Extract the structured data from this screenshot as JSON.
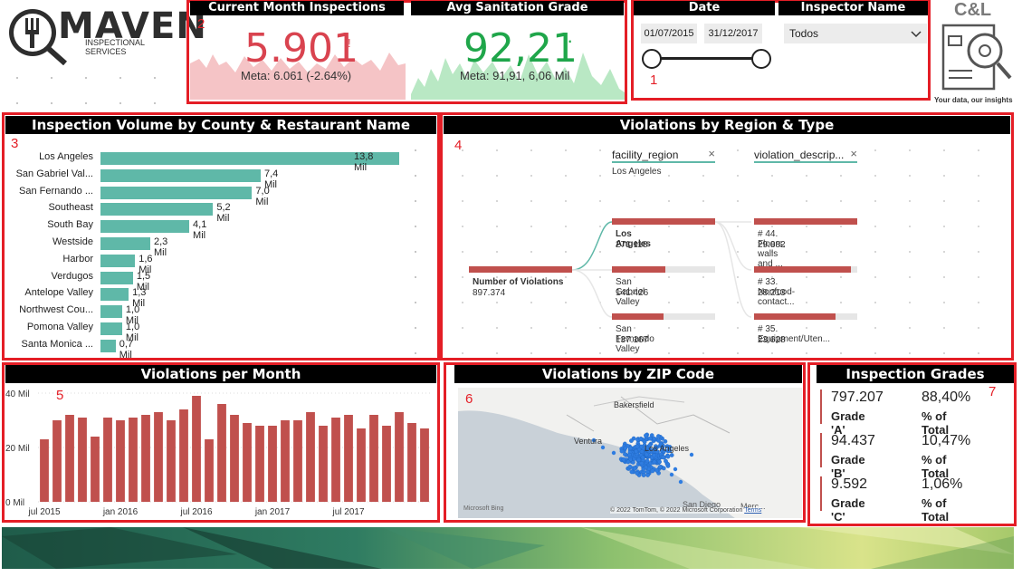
{
  "logo": {
    "title": "MAVEN",
    "subtitle": "INSPECTIONAL SERVICES",
    "brand": "C&L",
    "tagline": "Your data, our insights"
  },
  "kpis": {
    "current_month": {
      "header": "Current Month Inspections",
      "value": "5.901",
      "alert": "!",
      "goal": "Meta: 6.061 (-2.64%)",
      "color": "#d9434f"
    },
    "avg_grade": {
      "header": "Avg Sanitation Grade",
      "value": "92,21",
      "alert": "·",
      "goal": "Meta: 91,91, 6,06 Mil",
      "color": "#1fa64a"
    }
  },
  "slicers": {
    "date_header": "Date",
    "date_start": "01/07/2015",
    "date_end": "31/12/2017",
    "inspector_header": "Inspector Name",
    "inspector_value": "Todos"
  },
  "markers": [
    "1",
    "2",
    "3",
    "4",
    "5",
    "6",
    "7"
  ],
  "panels": {
    "county": "Inspection Volume by County & Restaurant Name",
    "region": "Violations by Region & Type",
    "monthly": "Violations per Month",
    "zip": "Violations by ZIP Code",
    "grades": "Inspection Grades"
  },
  "county_chart": {
    "chart_data": {
      "type": "bar",
      "categories": [
        "Los Angeles",
        "San Gabriel Val...",
        "San Fernando ...",
        "Southeast",
        "South Bay",
        "Westside",
        "Harbor",
        "Verdugos",
        "Antelope Valley",
        "Northwest Cou...",
        "Pomona Valley",
        "Santa Monica ..."
      ],
      "values": [
        13.8,
        7.4,
        7.0,
        5.2,
        4.1,
        2.3,
        1.6,
        1.5,
        1.3,
        1.0,
        1.0,
        0.7
      ],
      "labels": [
        "13,8 Mil",
        "7,4 Mil",
        "7,0 Mil",
        "5,2 Mil",
        "4,1 Mil",
        "2,3 Mil",
        "1,6 Mil",
        "1,5 Mil",
        "1,3 Mil",
        "1,0 Mil",
        "1,0 Mil",
        "0,7 Mil"
      ],
      "color": "#5fb8a8"
    }
  },
  "decomp": {
    "col1_header": "facility_region",
    "col1_filter": "Los Angeles",
    "col2_header": "violation_descrip...",
    "close_icon": "×",
    "root_label": "Number of Violations",
    "root_value": "897.374",
    "regions": [
      {
        "name": "Los Angeles",
        "value": "271.118",
        "frac": 1.0
      },
      {
        "name": "San Gabriel Valley",
        "value": "141.426",
        "frac": 0.52
      },
      {
        "name": "San Fernando Valley",
        "value": "137.167",
        "frac": 0.5
      }
    ],
    "types": [
      {
        "name": "# 44. Floors, walls and ...",
        "value": "29.882",
        "frac": 1.0
      },
      {
        "name": "# 33. Nonfood-contact...",
        "value": "28.213",
        "frac": 0.94
      },
      {
        "name": "# 35. Equipment/Uten...",
        "value": "23.628",
        "frac": 0.79
      }
    ]
  },
  "monthly_chart": {
    "chart_data": {
      "type": "bar",
      "yticks": [
        "40 Mil",
        "20 Mil",
        "0 Mil"
      ],
      "ylim": [
        0,
        40
      ],
      "xticks": [
        "jul 2015",
        "jan 2016",
        "jul 2016",
        "jan 2017",
        "jul 2017"
      ],
      "values": [
        23,
        30,
        32,
        31,
        24,
        31,
        30,
        31,
        32,
        33,
        30,
        34,
        39,
        23,
        36,
        32,
        29,
        28,
        28,
        30,
        30,
        33,
        28,
        31,
        32,
        27,
        32,
        28,
        33,
        29,
        27
      ],
      "color": "#c0504d"
    }
  },
  "map": {
    "labels": [
      "Bakersfield",
      "Ventura",
      "Los Angeles",
      "San Diego",
      "Merc..."
    ],
    "attribution": "© 2022 TomTom, © 2022 Microsoft Corporation",
    "terms": "Terms",
    "provider": "Microsoft Bing"
  },
  "grades": [
    {
      "count": "797.207",
      "label": "Grade 'A'",
      "pct": "88,40%",
      "pct_label": "% of Total"
    },
    {
      "count": "94.437",
      "label": "Grade 'B'",
      "pct": "10,47%",
      "pct_label": "% of Total"
    },
    {
      "count": "9.592",
      "label": "Grade 'C'",
      "pct": "1,06%",
      "pct_label": "% of Total"
    }
  ]
}
